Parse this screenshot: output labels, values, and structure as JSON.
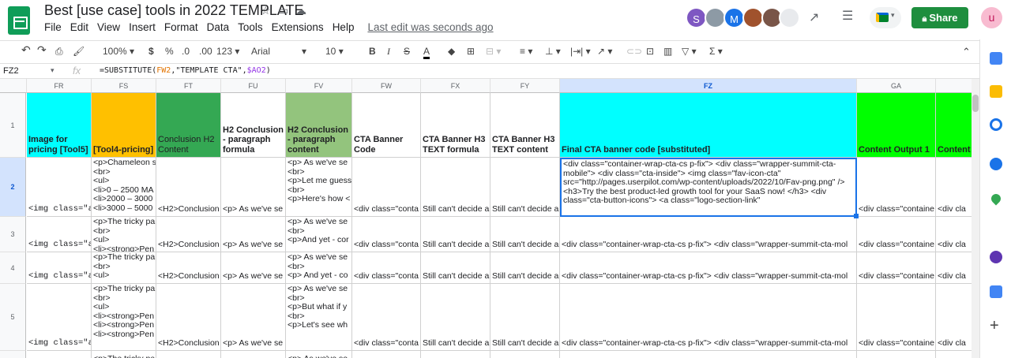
{
  "doc": {
    "title": "Best [use case] tools in 2022 TEMPLATE",
    "last_edit": "Last edit was seconds ago"
  },
  "menu": [
    "File",
    "Edit",
    "View",
    "Insert",
    "Format",
    "Data",
    "Tools",
    "Extensions",
    "Help"
  ],
  "share_label": "Share",
  "user_initial": "u",
  "avatars": [
    {
      "initial": "S",
      "color": "#7e57c2"
    },
    {
      "initial": "",
      "color": "#8d9aa5"
    },
    {
      "initial": "M",
      "color": "#1a73e8"
    },
    {
      "initial": "",
      "color": "#a0522d"
    },
    {
      "initial": "",
      "color": "#795548"
    },
    {
      "initial": "",
      "color": "#e8eaed"
    }
  ],
  "toolbar": {
    "zoom": "100%",
    "currency": "$",
    "percent": "%",
    "dec_dec": ".0",
    "inc_dec": ".00",
    "format": "123",
    "font": "Arial",
    "size": "10"
  },
  "formula_bar": {
    "cell_ref": "FZ2",
    "fx": "fx",
    "formula_prefix": "=SUBSTITUTE(",
    "ref1": "FW2",
    "mid": ",\"TEMPLATE CTA\",",
    "ref2": "$AO2",
    "suffix": ")"
  },
  "columns": [
    "FR",
    "FS",
    "FT",
    "FU",
    "FV",
    "FW",
    "FX",
    "FY",
    "FZ",
    "GA",
    ""
  ],
  "rows": [
    "1",
    "2",
    "3",
    "4",
    "5",
    ""
  ],
  "headers": [
    "Image for pricing [Tool5]",
    "[Tool4-pricing]",
    "Conclusion H2 Content",
    "H2 Conclusion - paragraph formula",
    "H2 Conclusion - paragraph content",
    "CTA Banner Code",
    "CTA Banner H3 TEXT formula",
    "CTA Banner H3 TEXT content",
    "Final CTA banner code [substituted]",
    "Content Output 1",
    "Content"
  ],
  "header_colors": [
    "#00ffff",
    "#ffc000",
    "#34a853",
    "#ffffff",
    "#93c47d",
    "#ffffff",
    "#ffffff",
    "#ffffff",
    "#00ffff",
    "#00ff00",
    "#00ff00"
  ],
  "row2": [
    "<img class=\"a",
    "<p>Chameleon s|<br>|<ul>|<li>0 – 2500 MA|<li>2000 – 3000|<li>3000 – 5000",
    "<H2>Conclusion",
    "<p> As we've se",
    "<p> As we've se|<br>|<p>Let me guess|<br>|<p>Here's how <",
    "<div class=\"conta",
    "Still can't decide a",
    "Still can't decide a",
    "<div class=\"container-wrap-cta-cs p-fix\"> <div class=\"wrapper-summit-cta-mobile\"> <div class=\"cta-inside\"> <img class=\"fav-icon-cta\" src=\"http://pages.userpilot.com/wp-content/uploads/2022/10/Fav-png.png\" /> <h3>Try the best product-led growth tool for your SaaS now! </h3> <div class=\"cta-button-icons\"> <a class=\"logo-section-link\"",
    "<div class=\"containe",
    "<div cla"
  ],
  "row3": [
    "<img class=\"a",
    "<p>The tricky pa|<br>|<ul>|<li><strong>Pen",
    "<H2>Conclusion",
    "<p> As we've se",
    "<p> As we've se|<br>|<p>And yet - cor",
    "<div class=\"conta",
    "Still can't decide a",
    "Still can't decide a",
    "<div class=\"container-wrap-cta-cs p-fix\"> <div class=\"wrapper-summit-cta-mol",
    "<div class=\"containe",
    "<div cla"
  ],
  "row4": [
    "<img class=\"a",
    "<p>The tricky pa|<br>|<ul>",
    "<H2>Conclusion",
    "<p> As we've se",
    "<p> As we've se|<br>|<p> And yet - co",
    "<div class=\"conta",
    "Still can't decide a",
    "Still can't decide a",
    "<div class=\"container-wrap-cta-cs p-fix\"> <div class=\"wrapper-summit-cta-mol",
    "<div class=\"containe",
    "<div cla"
  ],
  "row5": [
    "<img class=\"a",
    "<p>The tricky pa|<br>|<ul>|<li><strong>Pen|<li><strong>Pen|<li><strong>Pen",
    "<H2>Conclusion",
    "<p> As we've se",
    "<p> As we've se|<br>|<p>But what if y|<br>|<p>Let's see wh",
    "<div class=\"conta",
    "Still can't decide a",
    "Still can't decide a",
    "<div class=\"container-wrap-cta-cs p-fix\"> <div class=\"wrapper-summit-cta-mol",
    "<div class=\"containe",
    "<div cla"
  ],
  "row6": [
    "",
    "<p>The tricky pa",
    "",
    "",
    "<p> As we've se",
    "",
    "",
    "",
    "",
    "",
    ""
  ]
}
